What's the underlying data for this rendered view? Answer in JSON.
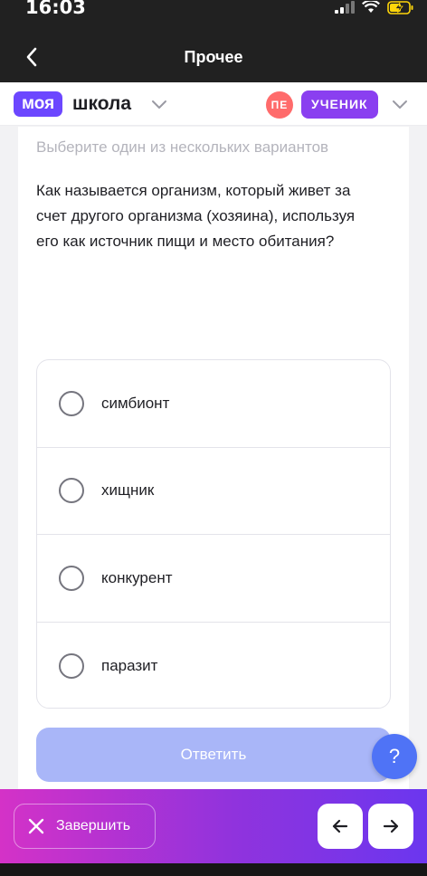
{
  "status_bar": {
    "time": "16:03"
  },
  "nav": {
    "title": "Прочее"
  },
  "app_header": {
    "logo_part1": "моя",
    "logo_part2": "школа",
    "avatar_initials": "ПЕ",
    "role": "УЧЕНИК"
  },
  "question": {
    "hint": "Выберите один из нескольких вариантов",
    "text": "Как называется организм, который живет за счет другого организма (хозяина), используя его как источник пищи и место обитания?",
    "options": [
      {
        "label": "симбионт"
      },
      {
        "label": "хищник"
      },
      {
        "label": "конкурент"
      },
      {
        "label": "паразит"
      }
    ]
  },
  "submit_label": "Ответить",
  "help_label": "?",
  "bottom": {
    "finish_label": "Завершить"
  },
  "colors": {
    "brand": "#6c47ff",
    "role_badge": "#8a3ff0",
    "avatar": "#ff6b6b",
    "submit_disabled": "#a9b6f8",
    "help": "#4f73f6"
  }
}
